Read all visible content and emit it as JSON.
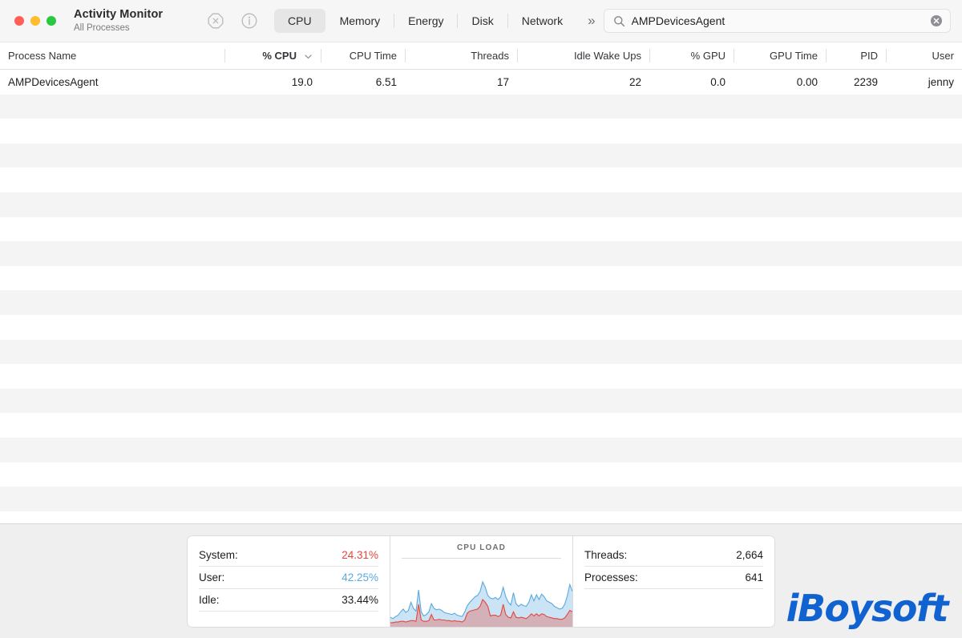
{
  "window": {
    "app_title": "Activity Monitor",
    "subtitle": "All Processes",
    "traffic_lights": {
      "close": "close-button",
      "minimize": "minimize-button",
      "maximize": "maximize-button"
    }
  },
  "toolbar": {
    "quit_process_label": "quit-process-icon",
    "inspect_label": "inspect-process-icon",
    "overflow_label": "»",
    "tabs": [
      {
        "label": "CPU",
        "active": true
      },
      {
        "label": "Memory",
        "active": false
      },
      {
        "label": "Energy",
        "active": false
      },
      {
        "label": "Disk",
        "active": false
      },
      {
        "label": "Network",
        "active": false
      }
    ]
  },
  "search": {
    "value": "AMPDevicesAgent",
    "placeholder": "Search",
    "icon": "search-icon",
    "clear_icon": "clear-search-icon"
  },
  "table": {
    "columns": [
      {
        "key": "name",
        "label": "Process Name",
        "align": "left",
        "sorted": false
      },
      {
        "key": "cpu",
        "label": "% CPU",
        "align": "right",
        "sorted": true
      },
      {
        "key": "cputime",
        "label": "CPU Time",
        "align": "right",
        "sorted": false
      },
      {
        "key": "threads",
        "label": "Threads",
        "align": "right",
        "sorted": false
      },
      {
        "key": "idle",
        "label": "Idle Wake Ups",
        "align": "right",
        "sorted": false
      },
      {
        "key": "gpu",
        "label": "% GPU",
        "align": "right",
        "sorted": false
      },
      {
        "key": "gputime",
        "label": "GPU Time",
        "align": "right",
        "sorted": false
      },
      {
        "key": "pid",
        "label": "PID",
        "align": "right",
        "sorted": false
      },
      {
        "key": "user",
        "label": "User",
        "align": "right",
        "sorted": false
      }
    ],
    "sort_direction": "descending",
    "rows": [
      {
        "name": "AMPDevicesAgent",
        "cpu": "19.0",
        "cputime": "6.51",
        "threads": "17",
        "idle": "22",
        "gpu": "0.0",
        "gputime": "0.00",
        "pid": "2239",
        "user": "jenny"
      }
    ],
    "empty_row_count": 17
  },
  "footer": {
    "cpu_stats": [
      {
        "label": "System:",
        "value": "24.31%",
        "color": "red"
      },
      {
        "label": "User:",
        "value": "42.25%",
        "color": "blue"
      },
      {
        "label": "Idle:",
        "value": "33.44%",
        "color": "default"
      }
    ],
    "graph": {
      "title": "CPU LOAD"
    },
    "counts": [
      {
        "label": "Threads:",
        "value": "2,664"
      },
      {
        "label": "Processes:",
        "value": "641"
      }
    ],
    "watermark": "iBoysoft"
  },
  "colors": {
    "system_red": "#e8453c",
    "user_blue": "#5aa9e0",
    "brand_blue": "#0f62d0",
    "window_chrome": "#f6f6f6",
    "footer_bg": "#efefef",
    "row_alt": "#f4f4f4"
  },
  "chart_data": {
    "type": "area",
    "title": "CPU LOAD",
    "xlabel": "",
    "ylabel": "",
    "ylim": [
      0,
      100
    ],
    "grid": false,
    "legend": "none",
    "series": [
      {
        "name": "User",
        "color": "#5aa9e0",
        "values": [
          14,
          12,
          15,
          17,
          22,
          26,
          21,
          24,
          36,
          27,
          23,
          54,
          22,
          16,
          18,
          22,
          34,
          27,
          25,
          26,
          24,
          21,
          20,
          19,
          18,
          20,
          17,
          16,
          15,
          22,
          31,
          36,
          40,
          44,
          46,
          52,
          66,
          58,
          46,
          42,
          41,
          43,
          40,
          44,
          58,
          44,
          36,
          32,
          50,
          34,
          30,
          33,
          31,
          30,
          36,
          47,
          38,
          47,
          40,
          48,
          44,
          38,
          36,
          34,
          30,
          28,
          26,
          27,
          33,
          45,
          62,
          52
        ]
      },
      {
        "name": "System",
        "color": "#e8453c",
        "values": [
          6,
          6,
          7,
          7,
          8,
          8,
          7,
          8,
          9,
          9,
          8,
          33,
          10,
          8,
          8,
          9,
          18,
          10,
          10,
          11,
          10,
          10,
          9,
          9,
          8,
          9,
          8,
          8,
          7,
          10,
          20,
          23,
          24,
          25,
          26,
          30,
          40,
          36,
          30,
          16,
          17,
          17,
          15,
          17,
          33,
          18,
          14,
          13,
          22,
          14,
          13,
          14,
          13,
          12,
          15,
          19,
          16,
          19,
          16,
          19,
          18,
          15,
          14,
          13,
          12,
          12,
          11,
          11,
          13,
          18,
          24,
          22
        ]
      }
    ]
  }
}
